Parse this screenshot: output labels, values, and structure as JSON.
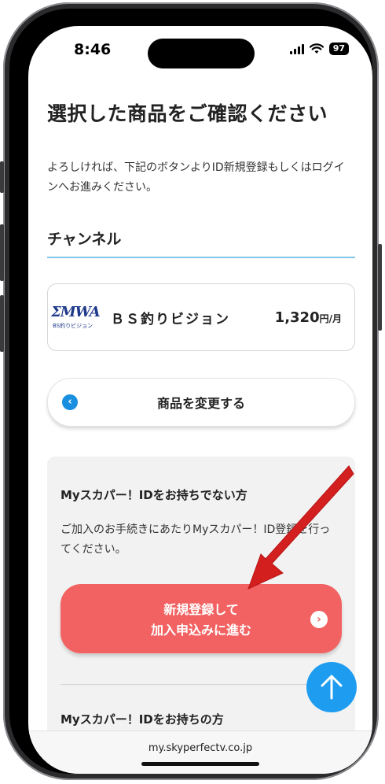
{
  "status_bar": {
    "time": "8:46",
    "battery": "97"
  },
  "page": {
    "title": "選択した商品をご確認ください",
    "lead": "よろしければ、下記のボタンよりID新規登録もしくはログインへお進みください。"
  },
  "section": {
    "heading": "チャンネル"
  },
  "product": {
    "logo_text": "BS釣りビジョン",
    "name": "ＢＳ釣りビジョン",
    "price": "1,320",
    "price_unit": "円/月"
  },
  "change_button": {
    "label": "商品を変更する"
  },
  "new_member": {
    "heading": "Myスカパー！IDをお持ちでない方",
    "text": "ご加入のお手続きにあたりMyスカパー！ID登録を行ってください。",
    "button_line1": "新規登録して",
    "button_line2": "加入申込みに進む"
  },
  "existing_member": {
    "heading": "Myスカパー！IDをお持ちの方"
  },
  "browser": {
    "url": "my.skyperfectv.co.jp"
  },
  "colors": {
    "accent_blue": "#1e9df0",
    "register_red": "#f26262",
    "arrow_red": "#d41f1f"
  }
}
